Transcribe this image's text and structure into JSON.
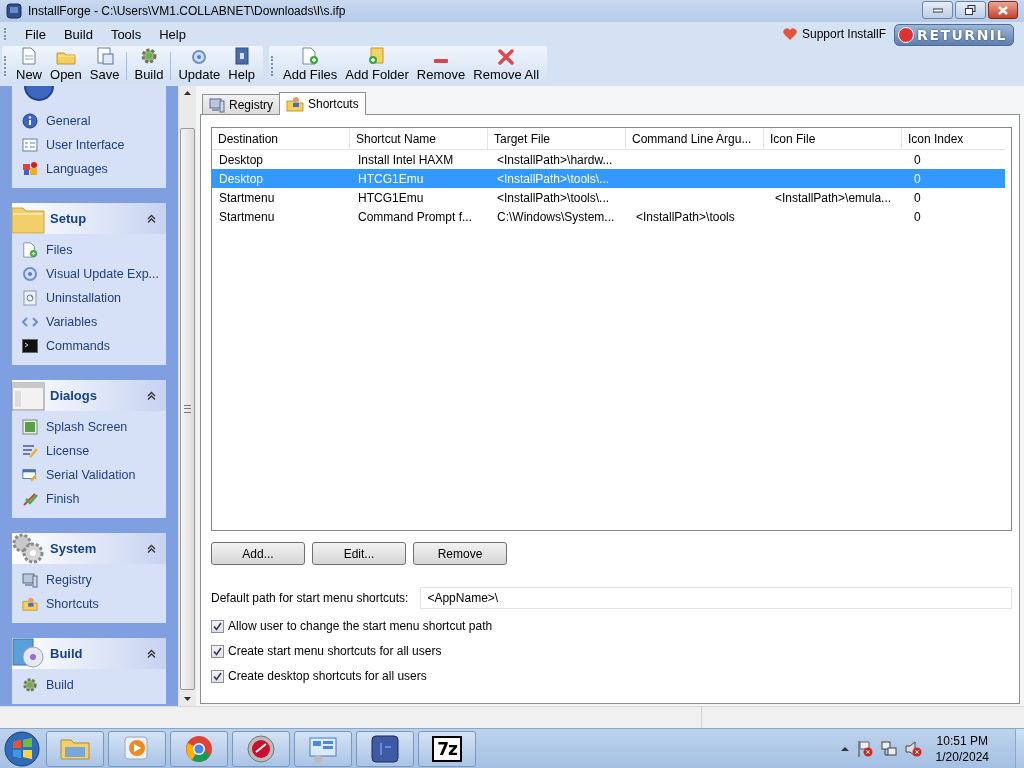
{
  "window": {
    "title": "InstallForge - C:\\Users\\VM1.COLLABNET\\Downloads\\I\\s.ifp"
  },
  "menu": [
    "File",
    "Build",
    "Tools",
    "Help"
  ],
  "support_link": "Support InstallF",
  "overlay_badge": "RETURNIL",
  "toolbar": {
    "groups": [
      [
        "New",
        "Open",
        "Save",
        "Build",
        "Update",
        "Help"
      ],
      [
        "Add Files",
        "Add Folder",
        "Remove",
        "Remove All"
      ]
    ]
  },
  "sidebar": {
    "groups": [
      {
        "items": [
          {
            "label": "General",
            "selected": false
          },
          {
            "label": "User Interface",
            "selected": false
          },
          {
            "label": "Languages",
            "selected": false
          }
        ]
      },
      {
        "title": "Setup",
        "expanded": true,
        "items": [
          {
            "label": "Files",
            "selected": false
          },
          {
            "label": "Visual Update Exp...",
            "selected": false
          },
          {
            "label": "Uninstallation",
            "selected": false
          },
          {
            "label": "Variables",
            "selected": false
          },
          {
            "label": "Commands",
            "selected": false
          }
        ]
      },
      {
        "title": "Dialogs",
        "expanded": true,
        "items": [
          {
            "label": "Splash Screen",
            "selected": false
          },
          {
            "label": "License",
            "selected": false
          },
          {
            "label": "Serial Validation",
            "selected": false
          },
          {
            "label": "Finish",
            "selected": false
          }
        ]
      },
      {
        "title": "System",
        "expanded": true,
        "items": [
          {
            "label": "Registry",
            "selected": false
          },
          {
            "label": "Shortcuts",
            "selected": false
          }
        ]
      },
      {
        "title": "Build",
        "expanded": true,
        "items": [
          {
            "label": "Build",
            "selected": false
          }
        ]
      }
    ]
  },
  "tabs": [
    {
      "label": "Registry",
      "selected": false
    },
    {
      "label": "Shortcuts",
      "selected": true
    }
  ],
  "table": {
    "columns": [
      "Destination",
      "Shortcut Name",
      "Target File",
      "Command Line Argu...",
      "Icon File",
      "Icon Index"
    ],
    "rows": [
      {
        "destination": "Desktop",
        "shortcut_name": "Install Intel HAXM",
        "target_file": "<InstallPath>\\hardw...",
        "icon_index": "0",
        "selected": false
      },
      {
        "destination": "Desktop",
        "shortcut_name": "HTCG1Emu",
        "target_file": "<InstallPath>\\tools\\...",
        "icon_index": "0",
        "selected": true
      },
      {
        "destination": "Startmenu",
        "shortcut_name": "HTCG1Emu",
        "target_file": "<InstallPath>\\tools\\...",
        "icon_file": "<InstallPath>\\emula...",
        "icon_index": "0",
        "selected": false
      },
      {
        "destination": "Startmenu",
        "shortcut_name": "Command Prompt f...",
        "target_file": "C:\\Windows\\System...",
        "command_line_arguments": "<InstallPath>\\tools",
        "icon_index": "0",
        "selected": false
      }
    ]
  },
  "buttons": [
    "Add...",
    "Edit...",
    "Remove"
  ],
  "default_path": {
    "label": "Default path for start menu shortcuts:",
    "value": "<AppName>\\"
  },
  "checkboxes": [
    {
      "label": "Allow user to change the start menu shortcut path",
      "checked": true
    },
    {
      "label": "Create start menu shortcuts for all users",
      "checked": true
    },
    {
      "label": "Create desktop shortcuts for all users",
      "checked": true
    }
  ],
  "taskbar": {
    "archive_label": "7z",
    "time": "10:51 PM",
    "date": "1/20/2024"
  }
}
